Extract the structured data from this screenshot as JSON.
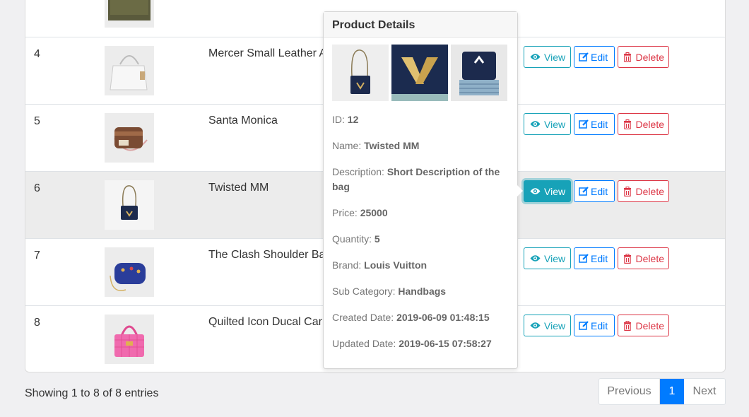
{
  "table": {
    "rows": [
      {
        "id": "4",
        "name": "Mercer Small Leather A"
      },
      {
        "id": "5",
        "name": "Santa Monica"
      },
      {
        "id": "6",
        "name": "Twisted MM"
      },
      {
        "id": "7",
        "name": "The Clash Shoulder Bag"
      },
      {
        "id": "8",
        "name": "Quilted Icon Ducal Carr"
      }
    ],
    "actions": {
      "view": "View",
      "edit": "Edit",
      "delete": "Delete"
    }
  },
  "popover": {
    "title": "Product Details",
    "id_label": "ID:",
    "id_value": "12",
    "name_label": "Name:",
    "name_value": "Twisted MM",
    "desc_label": "Description:",
    "desc_value": "Short Description of the bag",
    "price_label": "Price:",
    "price_value": "25000",
    "qty_label": "Quantity:",
    "qty_value": "5",
    "brand_label": "Brand:",
    "brand_value": "Louis Vuitton",
    "subcat_label": "Sub Category:",
    "subcat_value": "Handbags",
    "created_label": "Created Date:",
    "created_value": "2019-06-09 01:48:15",
    "updated_label": "Updated Date:",
    "updated_value": "2019-06-15 07:58:27"
  },
  "footer": {
    "info": "Showing 1 to 8 of 8 entries",
    "prev": "Previous",
    "page": "1",
    "next": "Next"
  },
  "colors": {
    "info": "#17a2b8",
    "primary": "#007bff",
    "danger": "#dc3545"
  }
}
